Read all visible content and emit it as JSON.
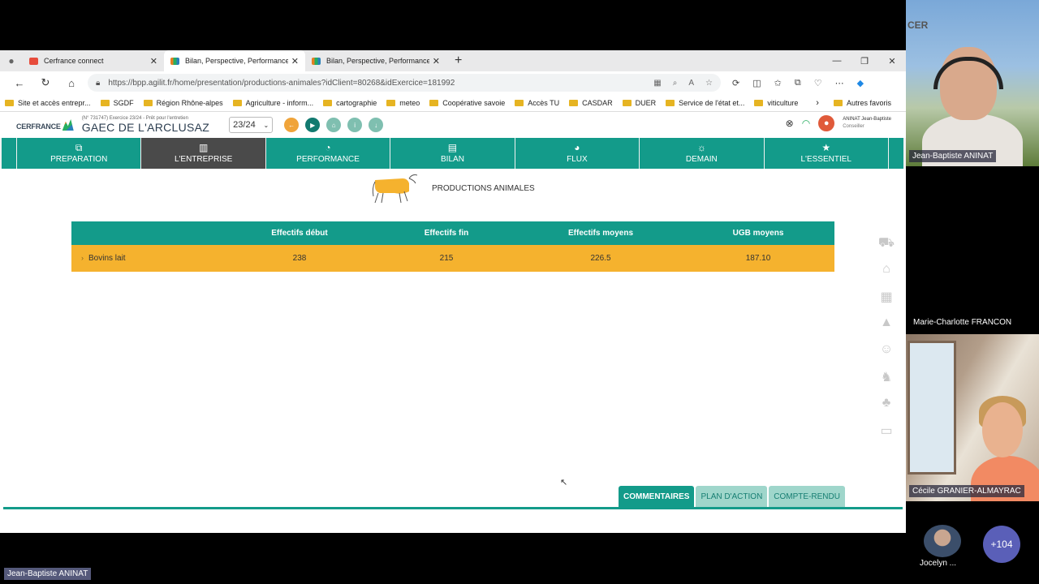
{
  "browser": {
    "tabs": [
      {
        "label": "Cerfrance connect",
        "favicon": "red"
      },
      {
        "label": "Bilan, Perspective, Performance",
        "favicon": "multi"
      },
      {
        "label": "Bilan, Perspective, Performance",
        "favicon": "multi"
      }
    ],
    "url": "https://bpp.agilit.fr/home/presentation/productions-animales?idClient=80268&idExercice=181992",
    "bookmarks": [
      "Site et accès entrepr...",
      "SGDF",
      "Région Rhône-alpes",
      "Agriculture - inform...",
      "cartographie",
      "meteo",
      "Coopérative savoie",
      "Accès TU",
      "CASDAR",
      "DUER",
      "Service de l'état et...",
      "viticulture"
    ],
    "other_bookmarks": "Autres favoris"
  },
  "app": {
    "logo_text": "CERFRANCE",
    "farm_sub": "(N° 731747) Exercice 23/24 - Prêt pour l'entretien",
    "farm_name": "GAEC DE L'ARCLUSAZ",
    "year": "23/24",
    "user_name": "ANINAT Jean-Baptiste",
    "user_role": "Conseiller",
    "nav": [
      {
        "label": "PREPARATION",
        "icon": "copy-icon"
      },
      {
        "label": "L'ENTREPRISE",
        "icon": "building-icon",
        "active": true
      },
      {
        "label": "PERFORMANCE",
        "icon": "gauge-icon"
      },
      {
        "label": "BILAN",
        "icon": "document-icon"
      },
      {
        "label": "FLUX",
        "icon": "piggybank-icon"
      },
      {
        "label": "DEMAIN",
        "icon": "sun-icon"
      },
      {
        "label": "L'ESSENTIEL",
        "icon": "star-icon"
      }
    ],
    "section_title": "PRODUCTIONS ANIMALES",
    "table": {
      "headers": [
        "",
        "Effectifs début",
        "Effectifs fin",
        "Effectifs moyens",
        "UGB moyens"
      ],
      "rows": [
        [
          "Bovins lait",
          "238",
          "215",
          "226.5",
          "187.10"
        ]
      ]
    },
    "bottom_tabs": [
      "COMMENTAIRES",
      "PLAN D'ACTION",
      "COMPTE-RENDU"
    ]
  },
  "meeting": {
    "participant_1": "Jean-Baptiste ANINAT",
    "participant_2_overlay": "Marie-Charlotte FRANCON",
    "participant_3": "Cécile GRANIER-ALMAYRAC",
    "participant_4": "Jocelyn ...",
    "others_count": "+104",
    "presenter": "Jean-Baptiste ANINAT",
    "video_text": "CER"
  },
  "colors": {
    "teal": "#139b8a",
    "orange": "#f5b22e",
    "active_nav": "#4a4a4a"
  }
}
